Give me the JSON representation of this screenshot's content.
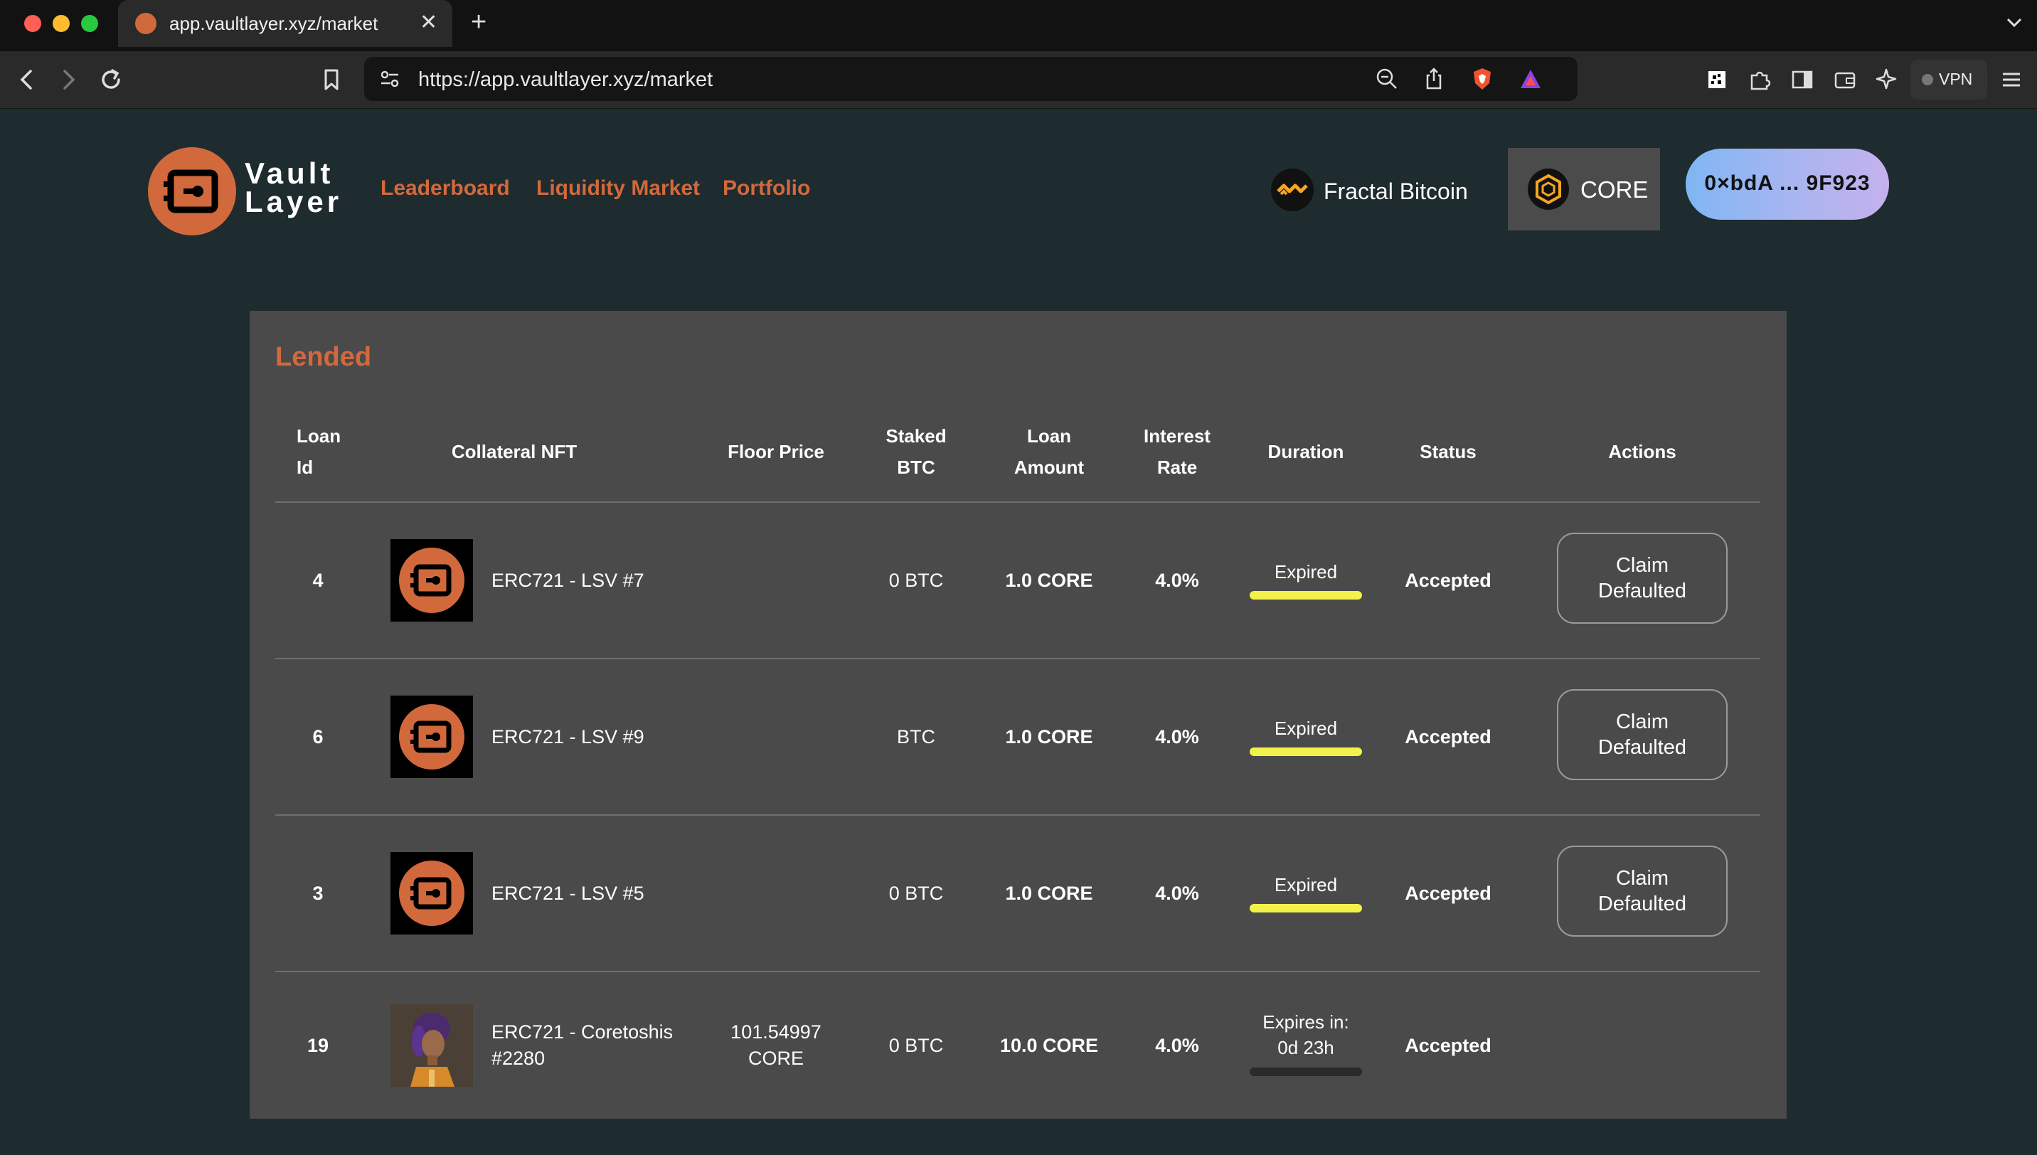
{
  "browser": {
    "tab_title": "app.vaultlayer.xyz/market",
    "url": "https://app.vaultlayer.xyz/market",
    "vpn_label": "VPN"
  },
  "header": {
    "logo_line1": "Vault",
    "logo_line2": "Layer",
    "nav": [
      "Leaderboard",
      "Liquidity Market",
      "Portfolio"
    ],
    "network_label": "Fractal Bitcoin",
    "chain_label": "CORE",
    "wallet_label": "0×bdA ... 9F923"
  },
  "panel": {
    "title": "Lended",
    "columns": {
      "loan_id": [
        "Loan",
        "Id"
      ],
      "collateral": "Collateral NFT",
      "floor_price": "Floor Price",
      "staked_btc": [
        "Staked",
        "BTC"
      ],
      "loan_amount": [
        "Loan",
        "Amount"
      ],
      "interest_rate": [
        "Interest",
        "Rate"
      ],
      "duration": "Duration",
      "status": "Status",
      "actions": "Actions"
    },
    "rows": [
      {
        "loan_id": "4",
        "nft_name": "ERC721 - LSV #7",
        "floor_price": "",
        "staked_btc": "0 BTC",
        "loan_amount": "1.0 CORE",
        "interest_rate": "4.0%",
        "duration": "Expired",
        "status": "Accepted",
        "action": "Claim Defaulted"
      },
      {
        "loan_id": "6",
        "nft_name": "ERC721 - LSV #9",
        "floor_price": "",
        "staked_btc": "BTC",
        "loan_amount": "1.0 CORE",
        "interest_rate": "4.0%",
        "duration": "Expired",
        "status": "Accepted",
        "action": "Claim Defaulted"
      },
      {
        "loan_id": "3",
        "nft_name": "ERC721 - LSV #5",
        "floor_price": "",
        "staked_btc": "0 BTC",
        "loan_amount": "1.0 CORE",
        "interest_rate": "4.0%",
        "duration": "Expired",
        "status": "Accepted",
        "action": "Claim Defaulted"
      },
      {
        "loan_id": "19",
        "nft_name": "ERC721 - Coretoshis #2280",
        "floor_price": "101.54997 CORE",
        "staked_btc": "0 BTC",
        "loan_amount": "10.0 CORE",
        "interest_rate": "4.0%",
        "duration": "Expires in: 0d 23h",
        "status": "Accepted",
        "action": ""
      }
    ]
  },
  "colors": {
    "page_bg": "#1e2b2f",
    "panel_bg": "#4a4a4a",
    "accent": "#d2693c",
    "expired_bar": "#f3f24a",
    "pending_bar": "#2a2a2a"
  }
}
